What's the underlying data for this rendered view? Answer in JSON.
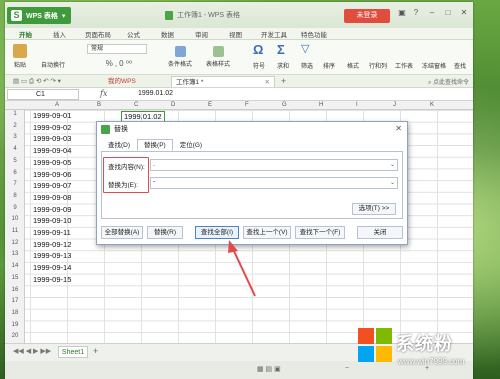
{
  "app": {
    "name": "WPS 表格",
    "window_title": "工作簿1 - WPS 表格",
    "login_label": "未登录"
  },
  "ribbon": {
    "tabs": [
      "开始",
      "插入",
      "页面布局",
      "公式",
      "数据",
      "审阅",
      "视图",
      "开发工具",
      "特色功能"
    ],
    "active_tab": "开始",
    "font_name": "常规",
    "buttons": {
      "paste": "粘贴",
      "wrap_text": "自动换行",
      "conditional_format": "条件格式",
      "table_style": "表格样式",
      "symbol": "符号",
      "sum": "求和",
      "filter": "筛选",
      "sort": "排序",
      "format": "格式",
      "row_col": "行和列",
      "worksheet": "工作表",
      "freeze": "冻结窗格",
      "find": "查找"
    }
  },
  "doc_tabs": {
    "mine": "我的WPS",
    "current": "工作簿1 *",
    "search_cmd": "点此查找命令"
  },
  "formula_bar": {
    "cell_ref": "C1",
    "fx": "fx",
    "value": "1999.01.02"
  },
  "grid": {
    "columns": [
      "A",
      "B",
      "C",
      "D",
      "E",
      "F",
      "G",
      "H",
      "I",
      "J",
      "K"
    ],
    "row_numbers": [
      "1",
      "2",
      "3",
      "4",
      "5",
      "6",
      "7",
      "8",
      "9",
      "10",
      "11",
      "12",
      "13",
      "14",
      "15",
      "16",
      "17",
      "18",
      "19",
      "20"
    ],
    "cells": [
      "1999-09-01",
      "1999-09-02",
      "1999-09-03",
      "1999-09-04",
      "1999-09-05",
      "1999-09-06",
      "1999-09-07",
      "1999-09-08",
      "1999-09-09",
      "1999-09-10",
      "1999-09-11",
      "1999-09-12",
      "1999-09-13",
      "1999-09-14",
      "1999-09-15"
    ],
    "c1_value": "1999.01.02"
  },
  "sheet": {
    "tab": "Sheet1"
  },
  "dialog": {
    "title": "替换",
    "tabs": [
      "查找(D)",
      "替换(P)",
      "定位(G)"
    ],
    "active_tab": "替换(P)",
    "find_label": "查找内容(N):",
    "find_value": ".",
    "replace_label": "替换为(E):",
    "replace_value": "-",
    "options_button": "选项(T) >>",
    "buttons": [
      "全部替换(A)",
      "替换(R)",
      "查找全部(I)",
      "查找上一个(V)",
      "查找下一个(F)",
      "关闭"
    ],
    "focused_button": "查找全部(I)"
  },
  "watermark": {
    "brand": "系统粉",
    "url": "www.win7999.com"
  },
  "colors": {
    "wps_green": "#3f9a3c",
    "login_red": "#e24c3c",
    "highlight_red": "#e24b4b",
    "accent_blue": "#4a83c6"
  }
}
